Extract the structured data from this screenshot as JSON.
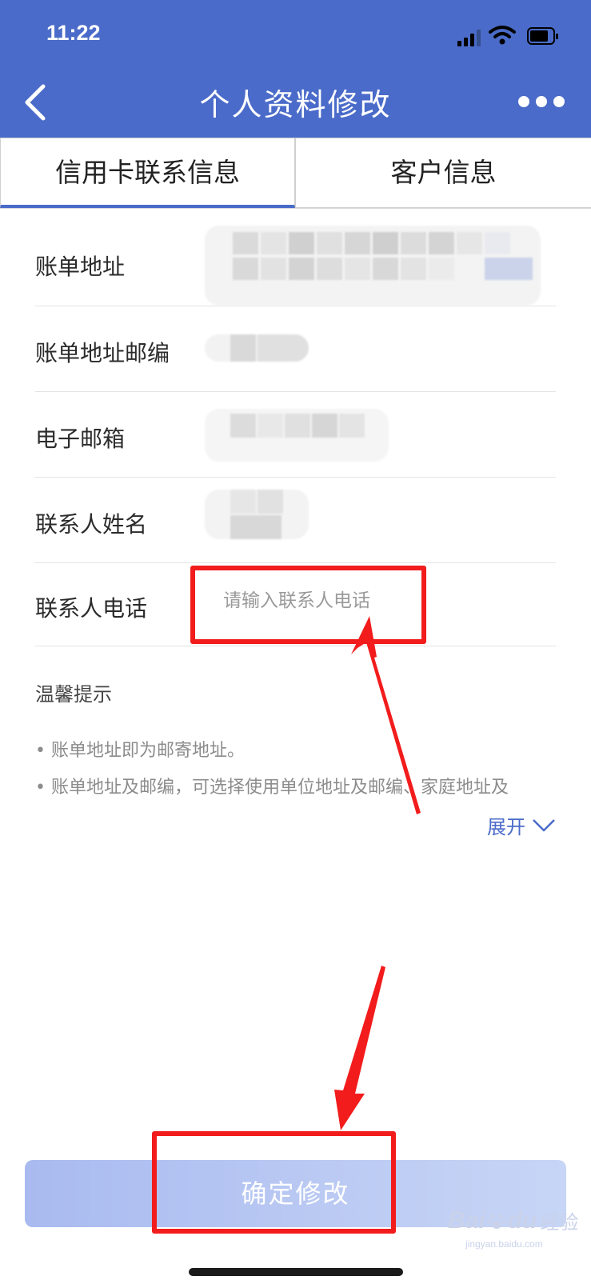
{
  "status_bar": {
    "time": "11:22"
  },
  "header": {
    "title": "个人资料修改"
  },
  "tabs": [
    {
      "label": "信用卡联系信息",
      "active": true
    },
    {
      "label": "客户信息",
      "active": false
    }
  ],
  "form": {
    "rows": [
      {
        "label": "账单地址"
      },
      {
        "label": "账单地址邮编"
      },
      {
        "label": "电子邮箱"
      },
      {
        "label": "联系人姓名"
      },
      {
        "label": "联系人电话",
        "placeholder": "请输入联系人电话",
        "value": ""
      }
    ]
  },
  "tips": {
    "title": "温馨提示",
    "lines": [
      "• 账单地址即为邮寄地址。",
      "• 账单地址及邮编，可选择使用单位地址及邮编、家庭地址及"
    ],
    "expand_label": "展开"
  },
  "confirm_label": "确定修改",
  "watermark": {
    "logo": "Bai",
    "logo2": "du",
    "text": "经验",
    "url": "jingyan.baidu.com"
  },
  "colors": {
    "header": "#4a6bc9",
    "accent": "#4a6bc9",
    "annotation": "#f21c1c",
    "button": "#bccbf3"
  }
}
